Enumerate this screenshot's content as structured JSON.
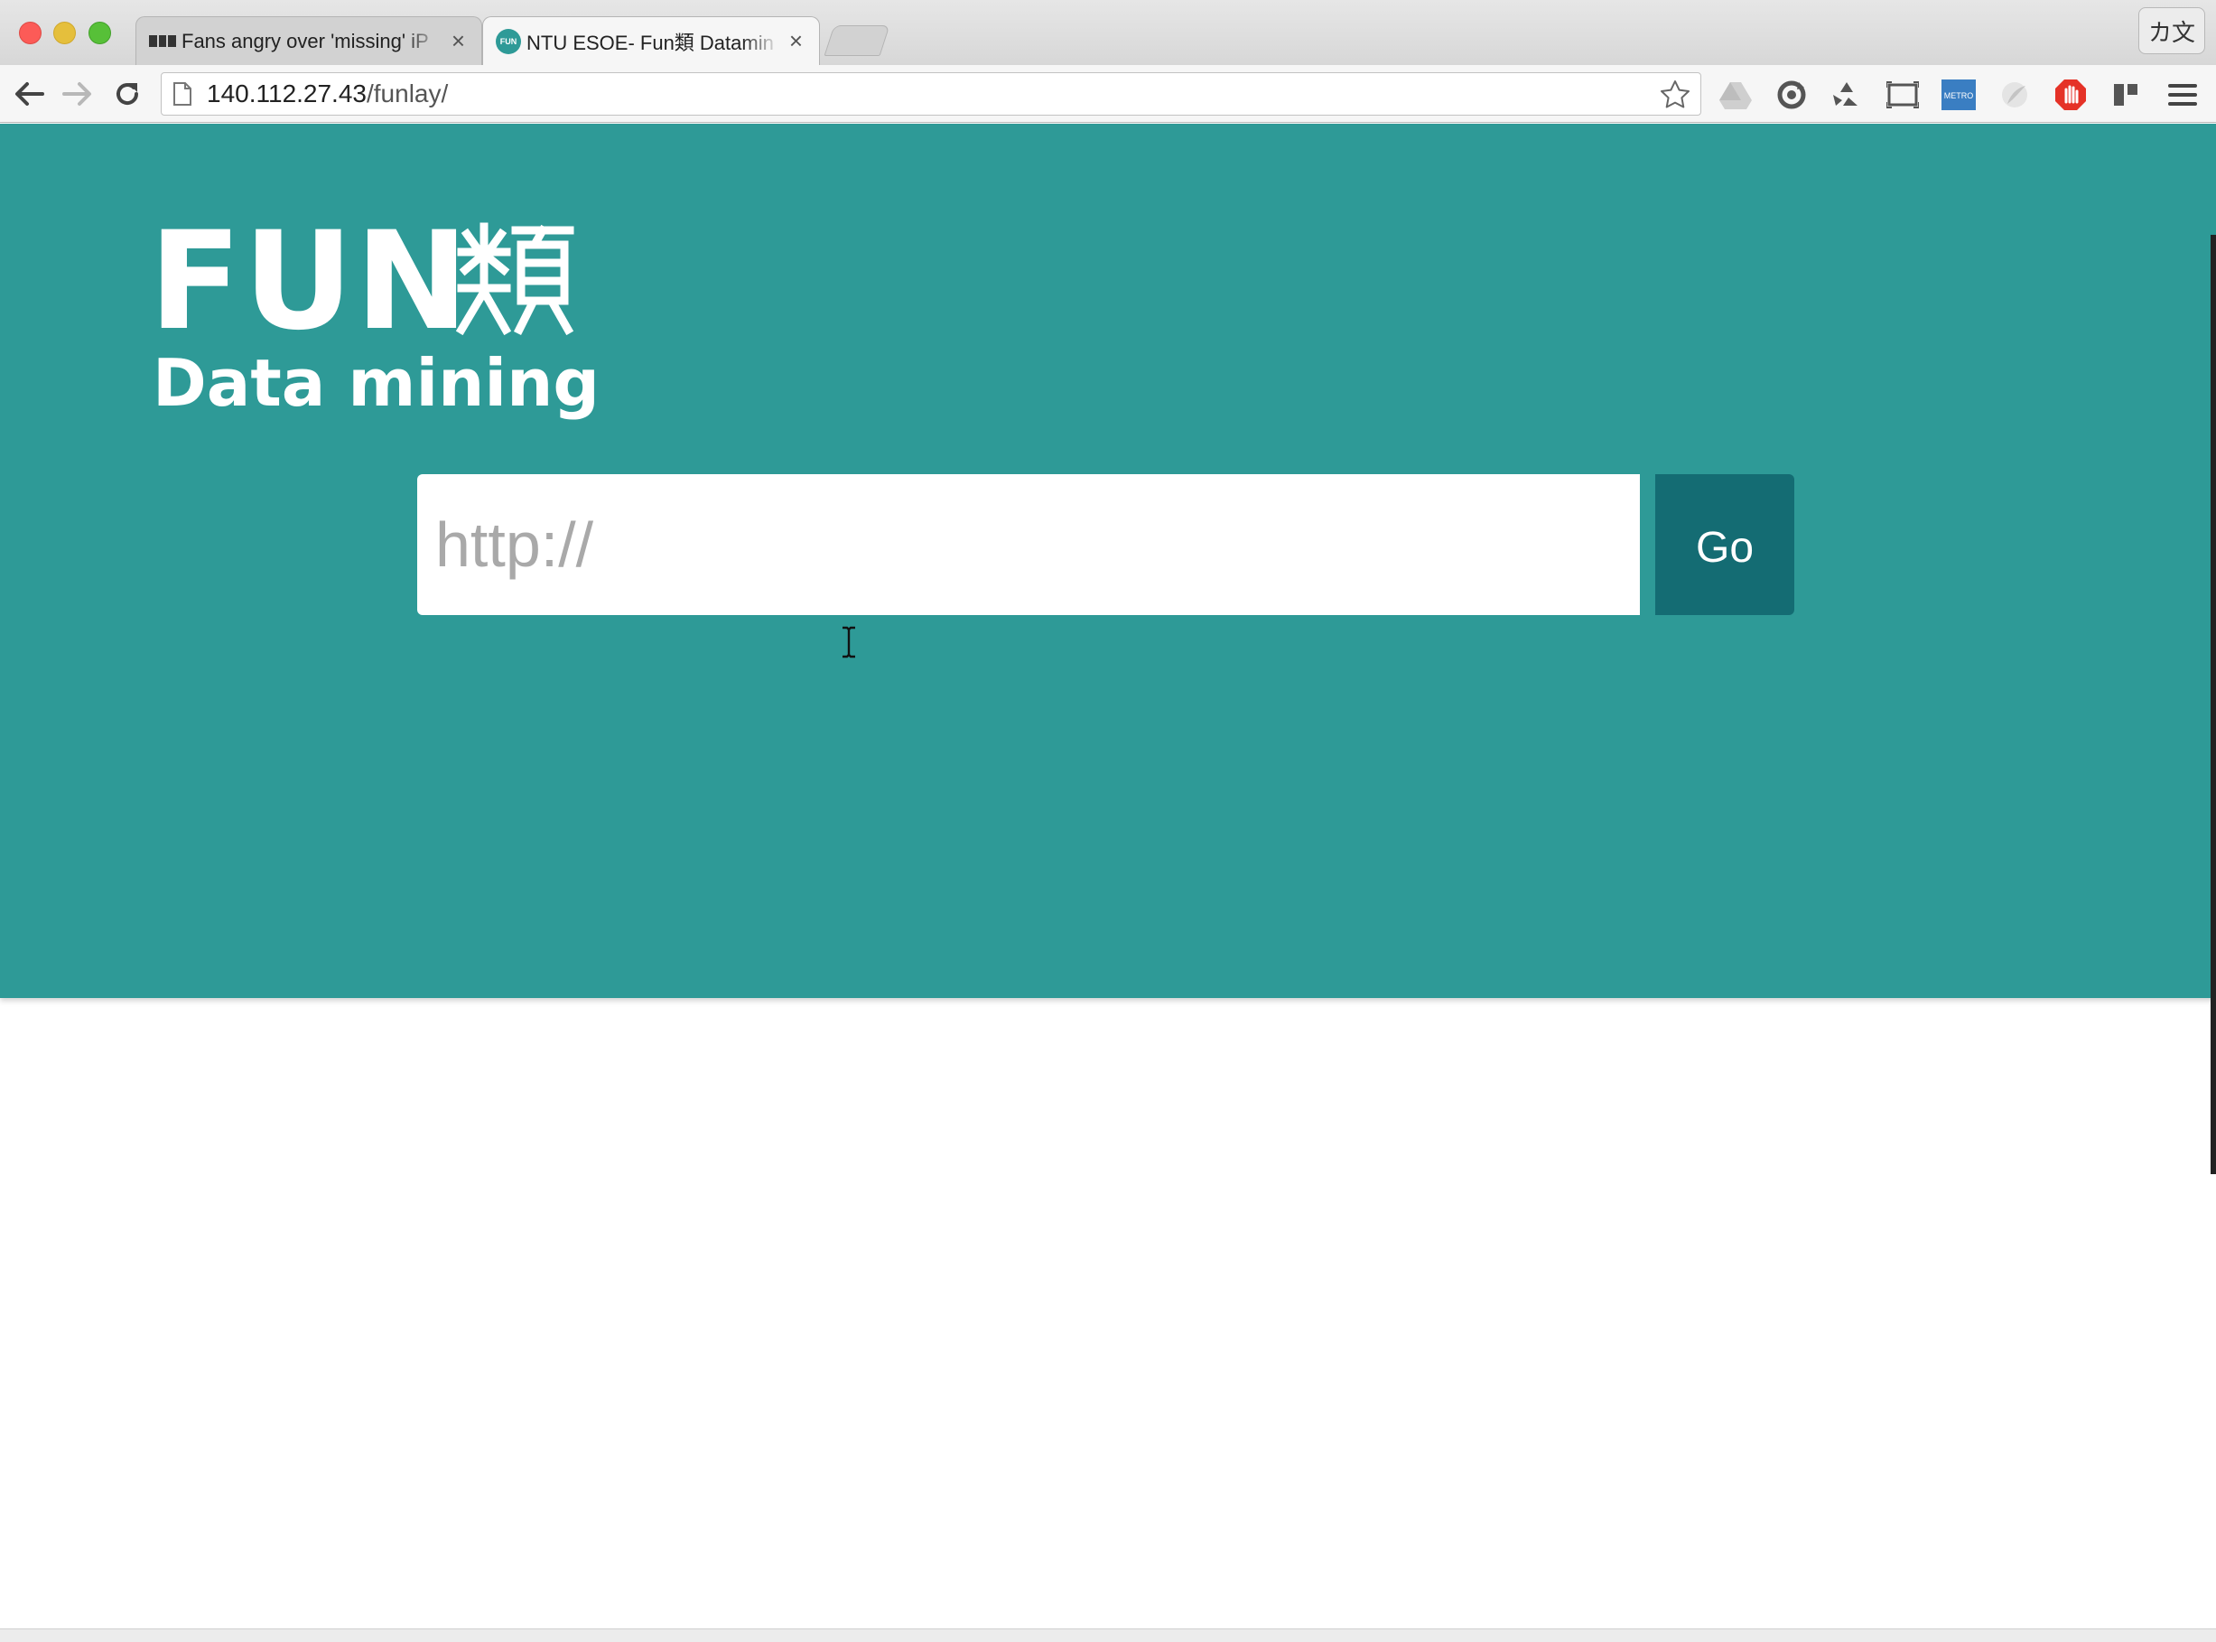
{
  "browser": {
    "tabs": [
      {
        "title": "Fans angry over 'missing' iP",
        "favicon": "bbc-icon",
        "active": false
      },
      {
        "title": "NTU ESOE- Fun類 Datamin",
        "favicon": "fun-favicon",
        "active": true
      }
    ],
    "close_glyph": "×",
    "language_button": "カ文",
    "url_host": "140.112.27.43",
    "url_path": "/funlay/",
    "extensions": [
      "google-drive-icon",
      "sync-icon",
      "recycle-icon",
      "screen-capture-icon",
      "metro-icon",
      "feather-icon",
      "adblock-icon",
      "panel-icon",
      "menu-icon"
    ],
    "metro_label": "METRO"
  },
  "page": {
    "logo": {
      "word": "FUN",
      "glyph": "類",
      "subtitle": "Data mining"
    },
    "search": {
      "placeholder": "http://",
      "value": ""
    },
    "go_label": "Go",
    "colors": {
      "hero_background": "#2e9a97",
      "go_button": "#146c73",
      "text_on_hero": "#ffffff"
    }
  }
}
